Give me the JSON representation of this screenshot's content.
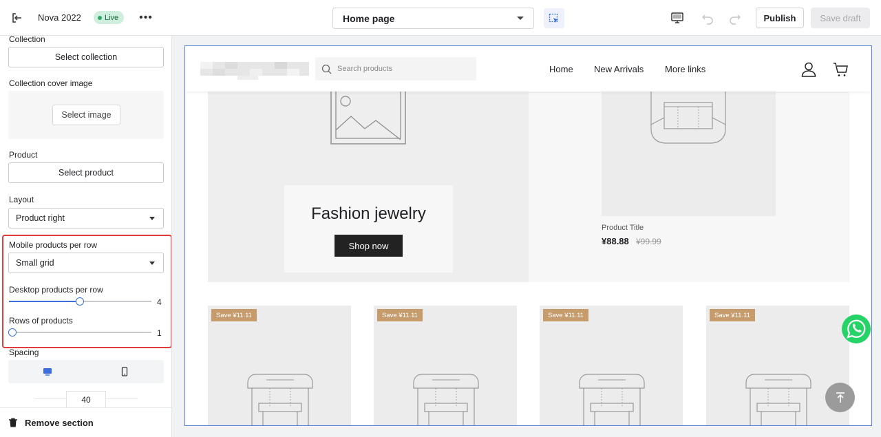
{
  "topbar": {
    "store_name": "Nova 2022",
    "live_label": "Live",
    "page_select": "Home page",
    "publish_label": "Publish",
    "save_draft_label": "Save draft"
  },
  "sidebar": {
    "collection_label": "Collection",
    "select_collection": "Select collection",
    "cover_label": "Collection cover image",
    "select_image": "Select image",
    "product_label": "Product",
    "select_product": "Select product",
    "layout_label": "Layout",
    "layout_value": "Product right",
    "mobile_label": "Mobile products per row",
    "mobile_value": "Small grid",
    "desktop_label": "Desktop products per row",
    "desktop_value": "4",
    "desktop_fraction": 0.5,
    "rows_label": "Rows of products",
    "rows_value": "1",
    "rows_fraction": 0,
    "spacing_label": "Spacing",
    "spacing_value": "40",
    "remove_label": "Remove section"
  },
  "store": {
    "search_placeholder": "Search products",
    "nav": [
      "Home",
      "New Arrivals",
      "More links"
    ],
    "hero_title": "Fashion jewelry",
    "shop_now": "Shop now",
    "product_title": "Product Title",
    "product_price": "¥88.88",
    "product_old_price": "¥99.99",
    "save_tags": [
      "Save ¥11.11",
      "Save ¥11.11",
      "Save ¥11.11",
      "Save ¥11.11"
    ]
  },
  "colors": {
    "accent": "#3b6fdb",
    "highlight": "#e23b3b",
    "live": "#2fa865",
    "save_tag": "#c69c6d",
    "whatsapp": "#25d366"
  }
}
